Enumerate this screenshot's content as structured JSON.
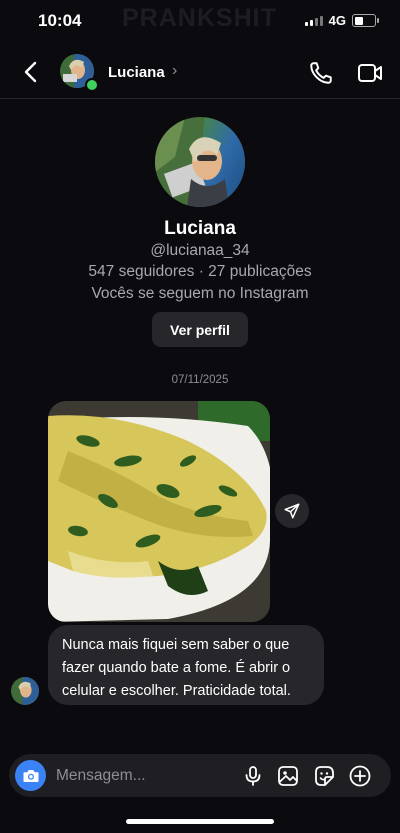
{
  "status_bar": {
    "time": "10:04",
    "network": "4G",
    "watermark": "PRANKSHIT"
  },
  "header": {
    "name": "Luciana",
    "chevron": "›",
    "icons": [
      "back-chevron-icon",
      "phone-icon",
      "video-camera-icon"
    ]
  },
  "profile": {
    "name": "Luciana",
    "handle": "@lucianaa_34",
    "stats": "547 seguidores · 27 publicações",
    "mutual": "Vocês se seguem no Instagram",
    "view_button": "Ver perfil"
  },
  "thread": {
    "date": "07/11/2025",
    "message": "Nunca mais fiquei sem saber o que fazer quando bate a fome. É abrir o celular e escolher. Praticidade total."
  },
  "composer": {
    "placeholder": "Mensagem...",
    "icons": [
      "camera-icon",
      "microphone-icon",
      "gallery-icon",
      "sticker-icon",
      "plus-icon"
    ]
  },
  "colors": {
    "background": "#0b0b0f",
    "bubble": "#26262b",
    "online": "#3fd15b",
    "camera_button": "#3b82f6"
  }
}
